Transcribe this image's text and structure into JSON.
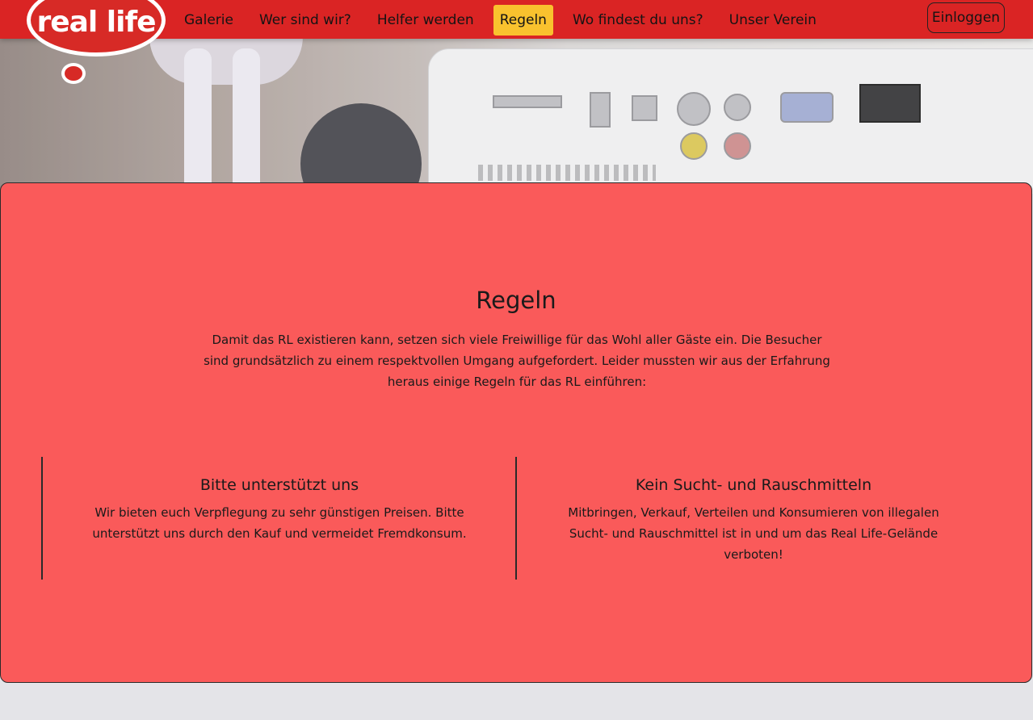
{
  "brand": {
    "logo_text": "real life"
  },
  "nav": {
    "items": [
      {
        "label": "Galerie",
        "active": false
      },
      {
        "label": "Wer sind wir?",
        "active": false
      },
      {
        "label": "Helfer werden",
        "active": false
      },
      {
        "label": "Regeln",
        "active": true
      },
      {
        "label": "Wo findest du uns?",
        "active": false
      },
      {
        "label": "Unser Verein",
        "active": false
      }
    ],
    "login_label": "Einloggen"
  },
  "main": {
    "title": "Regeln",
    "intro": "Damit das RL existieren kann, setzen sich viele Freiwillige für das Wohl aller Gäste ein. Die Besucher sind grundsätzlich zu einem respektvollen Umgang aufgefordert. Leider mussten wir aus der Erfahrung heraus einige Regeln für das RL einführen:",
    "rules": [
      {
        "title": "Bitte unterstützt uns",
        "text": "Wir bieten euch Verpflegung zu sehr günstigen Preisen. Bitte unterstützt uns durch den Kauf und vermeidet Fremdkonsum."
      },
      {
        "title": "Kein Sucht- und Rauschmitteln",
        "text": "Mitbringen, Verkauf, Verteilen und Konsumieren von illegalen Sucht- und Rauschmittel ist in und um das Real Life-Gelände verboten!"
      }
    ]
  },
  "colors": {
    "navbar": "#da2424",
    "active_nav": "#f9c22e",
    "card": "#fa5a5a",
    "page_bg": "#e4e4e8"
  }
}
